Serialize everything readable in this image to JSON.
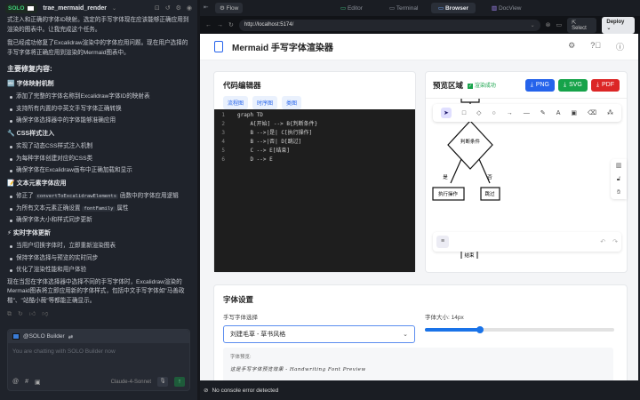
{
  "sidebar": {
    "brand": "SOLO",
    "project": "trae_mermaid_render",
    "intro": "式注入和正确的字体ID映射。选定的手写字体现在应该能够正确应用到渲染的图表中。让我完成这个任务。",
    "summary": "我已经成功修复了Excalidraw渲染中的字体应用问题。现在用户选择的手写字体将正确应用到渲染的Mermaid图表中。",
    "heading": "主要修复内容:",
    "sections": [
      {
        "icon": "🔤",
        "title": "字体映射机制",
        "items": [
          "添加了完整的字体名称到Excalidraw字体ID的映射表",
          "支持所有内置的中英文手写字体正确转换",
          "确保字体选择器中的字体能够准确应用"
        ]
      },
      {
        "icon": "🔧",
        "title": "CSS样式注入",
        "items": [
          "实现了动态CSS样式注入机制",
          "为每种字体创建对应的CSS类",
          "确保字体在Excalidraw画布中正确加载和显示"
        ]
      },
      {
        "icon": "📝",
        "title": "文本元素字体应用",
        "items": []
      },
      {
        "icon": "⚡",
        "title": "实时字体更新",
        "items": [
          "当用户切换字体时，立即重新渲染图表",
          "保持字体选择与预览的实时同步",
          "优化了渲染性能和用户体验"
        ]
      }
    ],
    "text_items": {
      "a_pre": "修正了",
      "a_code": "convertToExcalidrawElements",
      "a_post": "函数中的字体应用逻辑",
      "b_pre": "为所有文本元素正确设置",
      "b_code": "fontFamily",
      "b_post": "属性",
      "c": "确保字体大小和样式同步更新"
    },
    "closing": "现在当您在字体选择器中选择不同的手写字体时，Excalidraw渲染的Mermaid图表将立即应用新的字体样式，包括中文手写字体如\"马善政楷\"、\"站酷小薇\"等都能正确显示。",
    "chat": {
      "agent": "@SOLO Builder",
      "placeholder": "You are chatting with SOLO Builder now",
      "model": "Claude-4-Sonnet"
    }
  },
  "topbar": {
    "flow": "Flow",
    "tabs": [
      "Editor",
      "Terminal",
      "Browser",
      "DocView"
    ],
    "active_tab": "Browser",
    "url": "http://localhost:5174/",
    "select": "Select",
    "deploy": "Deploy"
  },
  "app": {
    "title": "Mermaid 手写字体渲染器",
    "editor": {
      "title": "代码编辑器",
      "templates": [
        "流程图",
        "时序图",
        "类图"
      ],
      "lines": [
        "graph TD",
        "    A[开始] --> B{判断条件}",
        "    B -->|是| C[执行操作]",
        "    B -->|否| D[跳过]",
        "    C --> E[结束]",
        "    D --> E"
      ]
    },
    "preview": {
      "title": "预览区域",
      "status": "渲染成功",
      "exports": [
        {
          "label": "PNG",
          "color": "#2563eb"
        },
        {
          "label": "SVG",
          "color": "#16a34a"
        },
        {
          "label": "PDF",
          "color": "#dc2626"
        }
      ],
      "nodes": {
        "decision": "判断条件",
        "yes": "是",
        "no": "否",
        "exec": "执行操作",
        "skip": "跳过",
        "end": "结束"
      }
    },
    "fonts": {
      "title": "字体设置",
      "font_label": "手写字体选择",
      "selected_font": "刘建毛草 - 草书风格",
      "size_label": "字体大小: 14px",
      "size_value": 14,
      "size_percent": 29,
      "preview_label": "字体预览:",
      "preview_text": "这是手写字体预览效果 - Handwriting Font Preview"
    }
  },
  "status": {
    "text": "No console error detected"
  }
}
